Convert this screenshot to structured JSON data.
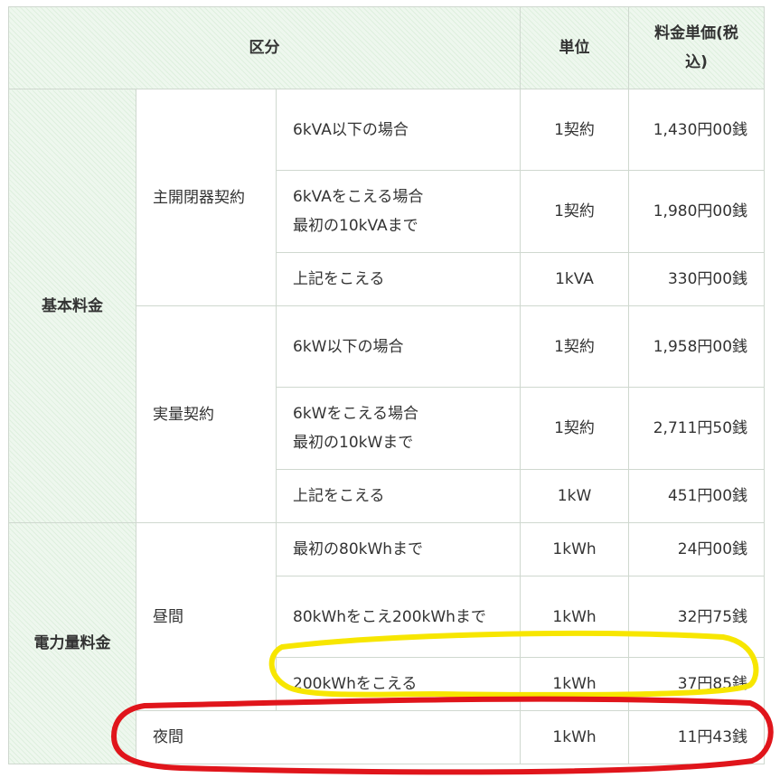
{
  "header": {
    "category": "区分",
    "unit": "単位",
    "price": "料金単価(税込)"
  },
  "groups": {
    "basic": "基本料金",
    "energy": "電力量料金"
  },
  "subgroups": {
    "main_breaker": "主開閉器契約",
    "actual": "実量契約",
    "daytime": "昼間",
    "night": "夜間"
  },
  "rows": [
    {
      "desc": "6kVA以下の場合",
      "unit": "1契約",
      "price": "1,430円00銭"
    },
    {
      "desc": "6kVAをこえる場合\n最初の10kVAまで",
      "unit": "1契約",
      "price": "1,980円00銭"
    },
    {
      "desc": "上記をこえる",
      "unit": "1kVA",
      "price": "330円00銭"
    },
    {
      "desc": "6kW以下の場合",
      "unit": "1契約",
      "price": "1,958円00銭"
    },
    {
      "desc": "6kWをこえる場合\n最初の10kWまで",
      "unit": "1契約",
      "price": "2,711円50銭"
    },
    {
      "desc": "上記をこえる",
      "unit": "1kW",
      "price": "451円00銭"
    },
    {
      "desc": "最初の80kWhまで",
      "unit": "1kWh",
      "price": "24円00銭"
    },
    {
      "desc": "80kWhをこえ200kWhまで",
      "unit": "1kWh",
      "price": "32円75銭"
    },
    {
      "desc": "200kWhをこえる",
      "unit": "1kWh",
      "price": "37円85銭"
    },
    {
      "desc": "",
      "unit": "1kWh",
      "price": "11円43銭"
    }
  ],
  "annotations": {
    "yellow_color": "#f7e600",
    "red_color": "#e0151b"
  }
}
